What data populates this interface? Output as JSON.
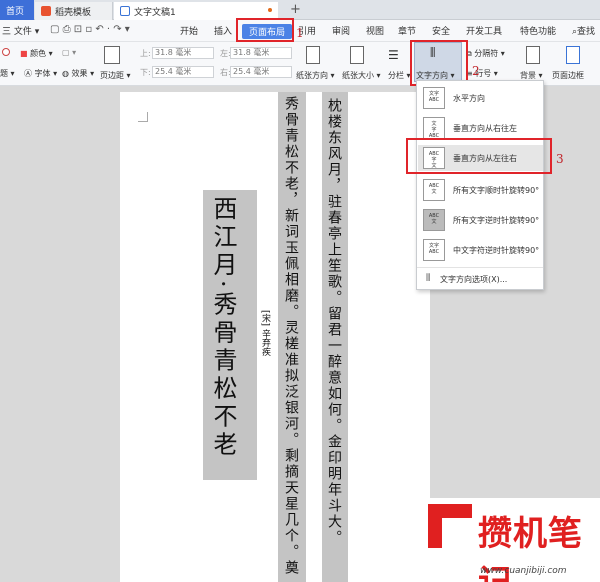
{
  "tabs": [
    {
      "label": "首页"
    },
    {
      "label": "稻壳模板"
    },
    {
      "label": "文字文稿1"
    }
  ],
  "tab_add": "+",
  "menu": {
    "file": "三 文件 ▾",
    "items": [
      "开始",
      "插入",
      "页面布局",
      "引用",
      "审阅",
      "视图",
      "章节",
      "安全",
      "开发工具",
      "特色功能"
    ],
    "search": "查找"
  },
  "ribbon": {
    "color_label": "颜色 ▾",
    "font_label": "字体 ▾",
    "effect_label": "效果 ▾",
    "theme_label": "题 ▾",
    "margin_label": "页边距 ▾",
    "top_label": "上:",
    "bottom_label": "下:",
    "left_label": "左:",
    "right_label": "右:",
    "top_value": "31.8 毫米",
    "bottom_value": "25.4 毫米",
    "left_value": "31.8 毫米",
    "right_value": "25.4 毫米",
    "orientation_label": "纸张方向 ▾",
    "size_label": "纸张大小 ▾",
    "columns_label": "分栏 ▾",
    "text_direction_label": "文字方向 ▾",
    "separator_label": "分隔符 ▾",
    "line_number_label": "行号 ▾",
    "background_label": "背景 ▾",
    "border_label": "页面边框"
  },
  "document": {
    "title": "西江月·秀骨青松不老",
    "author": "[宋] 辛弃疾",
    "line1": "秀骨青松不老，新词玉佩相磨。灵槎准拟泛银河。剩摘天星几个。奠",
    "line2": "枕楼东风月，驻春亭上笙歌。留君一醉意如何。金印明年斗大。"
  },
  "dropdown": {
    "items": [
      {
        "icon_text": "文字\nABC",
        "label": "水平方向"
      },
      {
        "icon_text": "文\n字\nABC",
        "label": "垂直方向从右往左"
      },
      {
        "icon_text": "ABC\n字\n文",
        "label": "垂直方向从左往右"
      },
      {
        "icon_text": "ABC\n文",
        "label": "所有文字顺时针旋转90°"
      },
      {
        "icon_text": "ABC\n文",
        "label": "所有文字逆时针旋转90°"
      },
      {
        "icon_text": "文字\nABC",
        "label": "中文字符逆时针旋转90°"
      }
    ],
    "options_label": "文字方向选项(X)..."
  },
  "annotations": {
    "step1": "1",
    "step2": "2",
    "step3": "3"
  },
  "watermark": {
    "title": "攒机笔记",
    "url": "www.cuanjibiji.com"
  },
  "colors": {
    "accent": "#4b82e6",
    "annotation_red": "#e0242a",
    "highlight_gray": "#c4c4c4",
    "watermark_red": "#e02020"
  }
}
